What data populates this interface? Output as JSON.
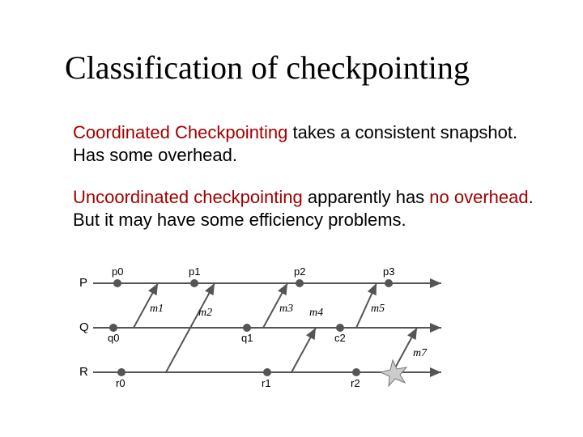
{
  "title": "Classification of checkpointing",
  "p1": {
    "term": "Coordinated Checkpointing",
    "rest1": " takes a consistent snapshot.",
    "line2": "Has some overhead."
  },
  "p2": {
    "term": "Uncoordinated checkpointing",
    "rest1": " apparently has ",
    "emph": "no overhead",
    "rest2": ".",
    "line2": "But it may have some efficiency problems."
  },
  "diagram": {
    "rows": [
      "P",
      "Q",
      "R"
    ],
    "points_P": [
      "p0",
      "p1",
      "p2",
      "p3"
    ],
    "points_Q": [
      "q0",
      "q1",
      "c2"
    ],
    "points_R": [
      "r0",
      "r1",
      "r2"
    ],
    "messages": [
      "m1",
      "m2",
      "m3",
      "m4",
      "m5",
      "m7"
    ]
  }
}
